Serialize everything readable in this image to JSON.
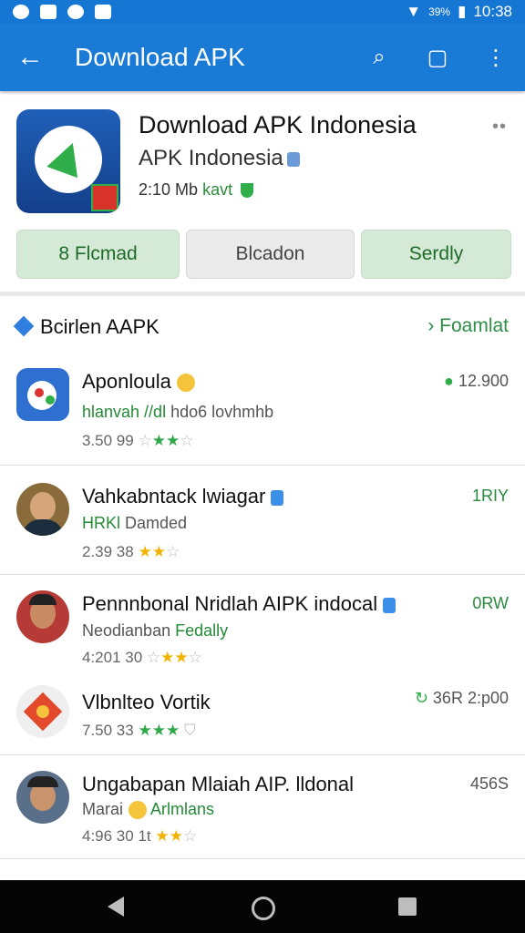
{
  "status_bar": {
    "time": "10:38",
    "battery": "39%"
  },
  "app_bar": {
    "title": "Download APK"
  },
  "app": {
    "title": "Download APK Indonesia",
    "developer": "APK Indonesia",
    "meta_prefix": "2:10 Mb",
    "meta_green": "kavt",
    "buttons": [
      "8 Flcmad",
      "Blcadon",
      "Serdly"
    ]
  },
  "section": {
    "title": "Bcirlen AAPK",
    "link": "Foamlat"
  },
  "list": [
    {
      "name": "Aponloula",
      "sub_green": "hlanvah //dl",
      "sub_grey": "hdo6 lovhmhb",
      "meta": "3.50  99",
      "right": "12.900"
    },
    {
      "name": "Vahkabntack lwiagar",
      "sub_green": "HRKl",
      "sub_grey": "Damded",
      "meta": "2.39  38",
      "right": "1RIY"
    },
    {
      "name": "Pennnbonal Nridlah AIPK indocal",
      "sub_grey": "Neodianban",
      "sub_green": "Fedally",
      "meta": "4:201  30",
      "right": "0RW"
    },
    {
      "name": "Vlbnlteo Vortik",
      "meta": "7.50  33",
      "right": "36R 2:p00"
    },
    {
      "name": "Ungabapan Mlaiah AIP. lldonal",
      "sub_grey": "Marai",
      "sub_green": "Arlmlans",
      "meta": "4:96  30 1t",
      "right": "456S"
    }
  ],
  "colors": {
    "primary": "#1a7bd6",
    "green": "#2fae4a",
    "star": "#f0b400"
  }
}
